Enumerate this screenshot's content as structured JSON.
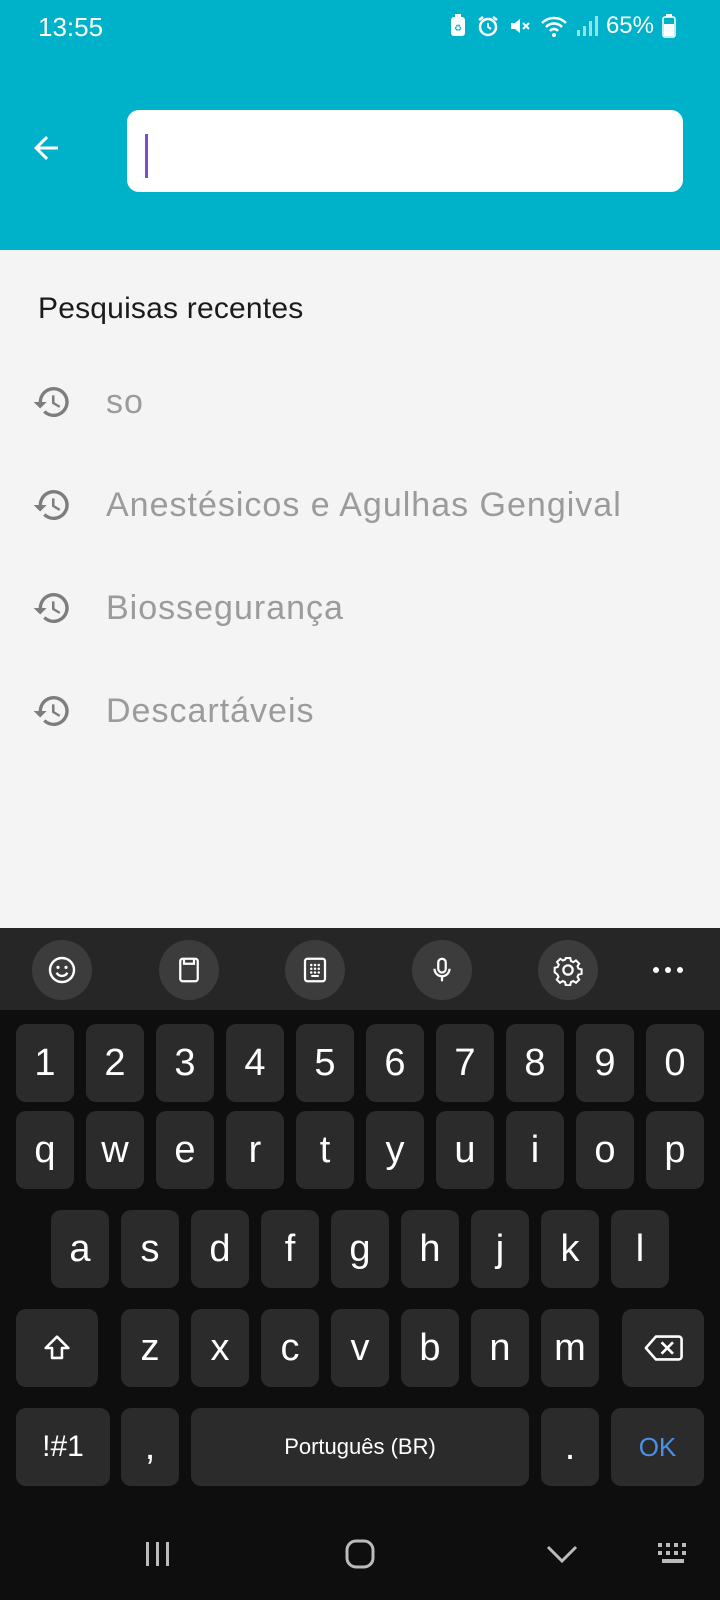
{
  "status": {
    "time": "13:55",
    "battery": "65%",
    "icons": [
      "battery-saver-icon",
      "alarm-icon",
      "mute-icon",
      "wifi-icon",
      "signal-icon",
      "battery-icon"
    ]
  },
  "appbar": {
    "back_icon": "arrow-left-icon",
    "search_value": "",
    "search_placeholder": "",
    "color": "#00b2c9"
  },
  "recent": {
    "title": "Pesquisas recentes",
    "items": [
      {
        "icon": "history-icon",
        "label": "so"
      },
      {
        "icon": "history-icon",
        "label": "Anestésicos e Agulhas Gengival"
      },
      {
        "icon": "history-icon",
        "label": "Biossegurança"
      },
      {
        "icon": "history-icon",
        "label": "Descartáveis"
      }
    ]
  },
  "keyboard": {
    "toolbar": [
      "emoji-icon",
      "clipboard-icon",
      "keypad-icon",
      "mic-icon",
      "settings-icon",
      "more-icon"
    ],
    "row_numbers": [
      "1",
      "2",
      "3",
      "4",
      "5",
      "6",
      "7",
      "8",
      "9",
      "0"
    ],
    "row1": [
      "q",
      "w",
      "e",
      "r",
      "t",
      "y",
      "u",
      "i",
      "o",
      "p"
    ],
    "row2": [
      "a",
      "s",
      "d",
      "f",
      "g",
      "h",
      "j",
      "k",
      "l"
    ],
    "row3": [
      "z",
      "x",
      "c",
      "v",
      "b",
      "n",
      "m"
    ],
    "sym_label": "!#1",
    "comma_label": ",",
    "space_label": "Português (BR)",
    "period_label": ".",
    "ok_label": "OK",
    "accent_color": "#4b8fe8"
  },
  "navbar": {
    "icons": [
      "recents-icon",
      "home-icon",
      "hide-keyboard-icon",
      "keyboard-switch-icon"
    ]
  }
}
